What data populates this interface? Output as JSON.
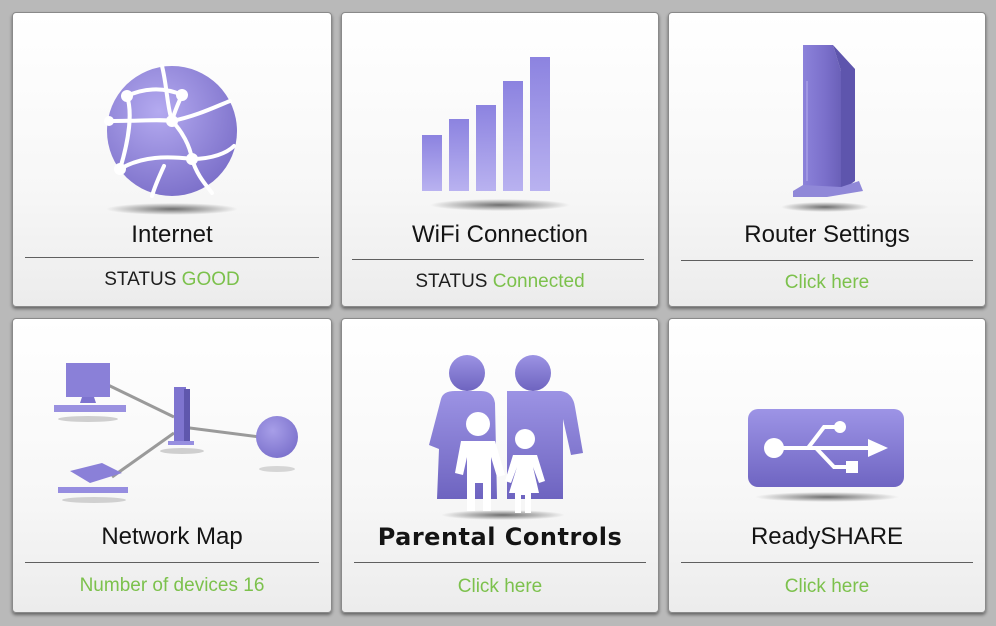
{
  "colors": {
    "accent_purple": "#8a7fd6",
    "status_green": "#7cc14c",
    "background": "#b9b9b9"
  },
  "tiles": [
    {
      "title": "Internet",
      "status_prefix": "STATUS",
      "status_value": "GOOD",
      "icon": "globe-icon"
    },
    {
      "title": "WiFi Connection",
      "status_prefix": "STATUS",
      "status_value": "Connected",
      "icon": "signal-bars-icon"
    },
    {
      "title": "Router Settings",
      "link": "Click here",
      "icon": "router-icon"
    },
    {
      "title": "Network Map",
      "status_text": "Number of devices 16",
      "icon": "network-map-icon"
    },
    {
      "title": "Parental Controls",
      "link": "Click here",
      "icon": "family-icon"
    },
    {
      "title": "ReadySHARE",
      "link": "Click here",
      "icon": "usb-icon"
    }
  ]
}
